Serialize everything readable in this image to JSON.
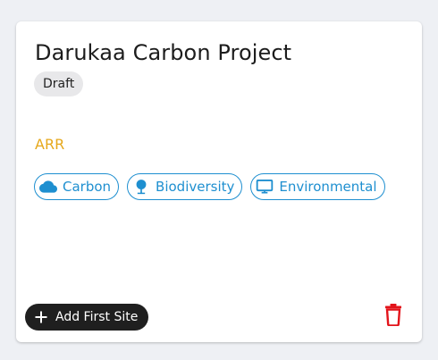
{
  "project": {
    "title": "Darukaa Carbon Project",
    "status": "Draft",
    "category": "ARR",
    "tags": [
      {
        "label": "Carbon",
        "icon": "cloud-icon"
      },
      {
        "label": "Biodiversity",
        "icon": "tree-icon"
      },
      {
        "label": "Environmental",
        "icon": "monitor-icon"
      }
    ]
  },
  "actions": {
    "add_site_label": "Add First Site",
    "add_icon": "plus-icon",
    "delete_icon": "trash-icon"
  },
  "colors": {
    "accent_blue": "#1e8fd0",
    "category_orange": "#e6a81c",
    "delete_red": "#e3141b",
    "button_dark": "#1f1f1f",
    "status_chip_bg": "#e8e8ea"
  }
}
